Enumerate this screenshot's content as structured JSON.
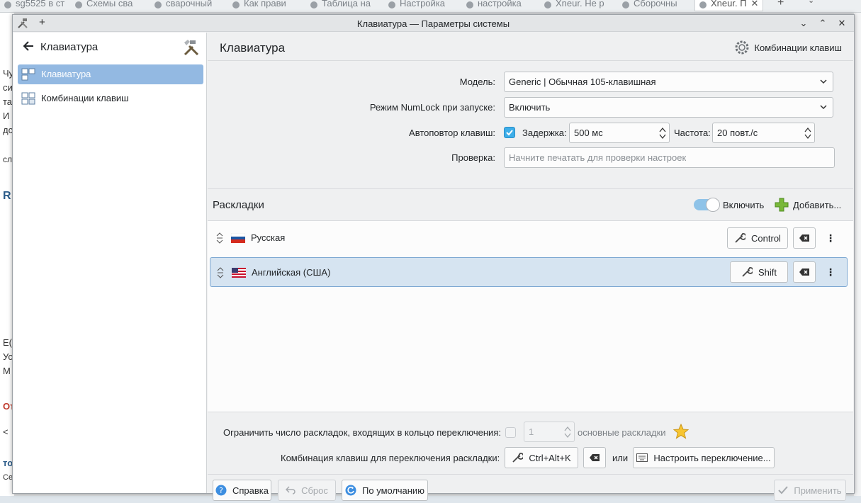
{
  "browser": {
    "tabs": [
      {
        "label": "sg5525 в ст"
      },
      {
        "label": "Схемы сва"
      },
      {
        "label": "сварочный"
      },
      {
        "label": "Как прави"
      },
      {
        "label": "Таблица на"
      },
      {
        "label": "Настройка"
      },
      {
        "label": "настройка"
      },
      {
        "label": "Xneur. Не р"
      },
      {
        "label": "Сборочны"
      },
      {
        "label": "Xneur. П"
      }
    ],
    "new_tab": "+",
    "bg_text_lines": [
      "Чу",
      "си",
      "та",
      "И",
      "дс",
      "сл",
      "R",
      "Е(",
      "Ус",
      "М",
      "От",
      "<",
      "то",
      "Сей"
    ]
  },
  "window": {
    "title": "Клавиатура — Параметры системы",
    "plus": "+"
  },
  "sidebar": {
    "title": "Клавиатура",
    "items": [
      {
        "label": "Клавиатура",
        "selected": true
      },
      {
        "label": "Комбинации клавиш",
        "selected": false
      }
    ]
  },
  "main": {
    "title": "Клавиатура",
    "shortcuts_button": "Комбинации клавиш",
    "model_label": "Модель:",
    "model_value": "Generic | Обычная 105-клавишная",
    "numlock_label": "Режим NumLock при запуске:",
    "numlock_value": "Включить",
    "repeat_label": "Автоповтор клавиш:",
    "repeat_checked": true,
    "delay_label": "Задержка:",
    "delay_value": "500 мс",
    "rate_label": "Частота:",
    "rate_value": "20 повт./с",
    "test_label": "Проверка:",
    "test_placeholder": "Начните печатать для проверки настроек"
  },
  "layouts": {
    "title": "Раскладки",
    "toggle_label": "Включить",
    "toggle_on": true,
    "add_label": "Добавить...",
    "items": [
      {
        "name": "Русская",
        "shortcut": "Control",
        "selected": false
      },
      {
        "name": "Английская (США)",
        "shortcut": "Shift",
        "selected": true
      }
    ]
  },
  "bottom": {
    "limit_label": "Ограничить число раскладок, входящих в кольцо переключения:",
    "limit_value": "1",
    "limit_suffix": "основные раскладки",
    "switch_label": "Комбинация клавиш для переключения раскладки:",
    "switch_value": "Ctrl+Alt+K",
    "or_label": "или",
    "configure_label": "Настроить переключение..."
  },
  "footer": {
    "help": "Справка",
    "reset": "Сброс",
    "defaults": "По умолчанию",
    "apply": "Применить"
  },
  "colors": {
    "accent": "#3daee9",
    "selection": "#93b9e2",
    "window_bg": "#eff0f1"
  }
}
